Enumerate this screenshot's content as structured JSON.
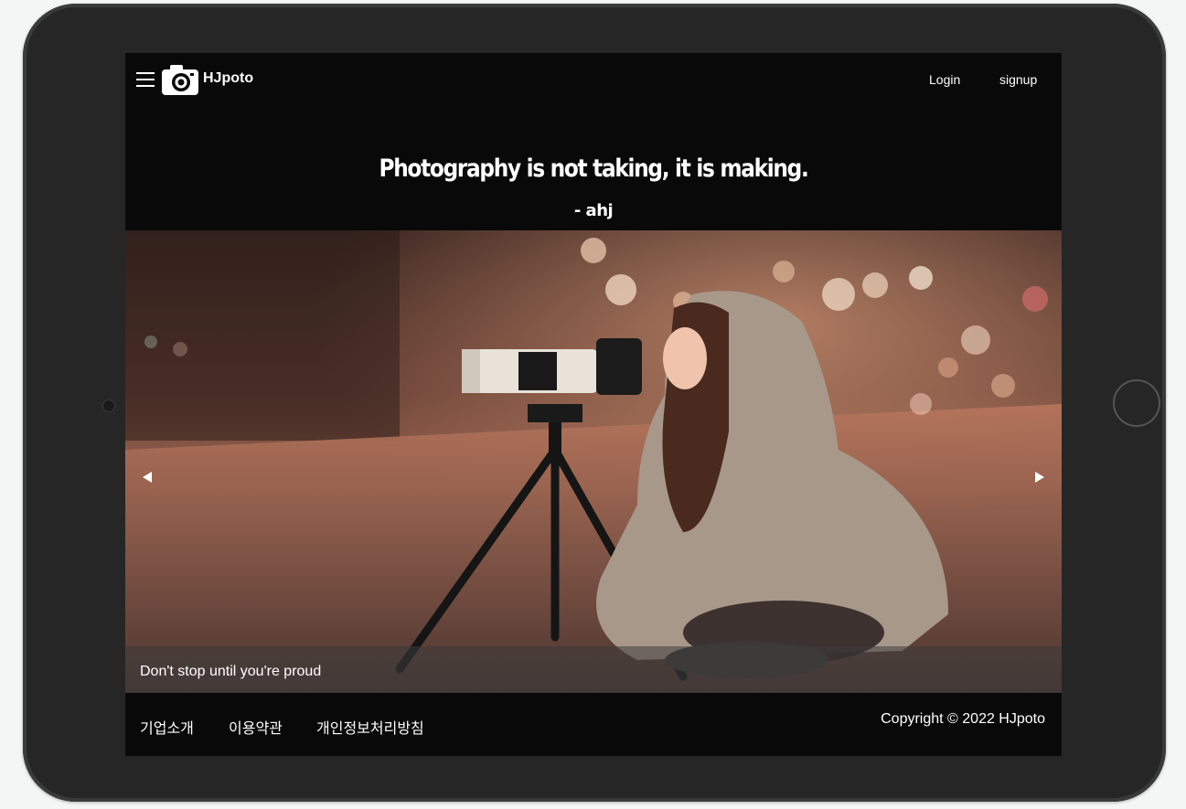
{
  "nav": {
    "brand": "HJpoto",
    "login": "Login",
    "signup": "signup"
  },
  "hero": {
    "quote": "Photography is not taking, it is making.",
    "author": "- ahj"
  },
  "carousel": {
    "caption": "Don't stop until you're proud"
  },
  "footer": {
    "links": [
      "기업소개",
      "이용약관",
      "개인정보처리방침"
    ],
    "copyright": "Copyright © 2022 HJpoto"
  },
  "colors": {
    "screen_bg": "#090909",
    "device_frame": "#262626",
    "text": "#ffffff"
  },
  "icons": {
    "menu": "hamburger-icon",
    "logo": "camera-icon",
    "prev": "triangle-left-icon",
    "next": "triangle-right-icon"
  }
}
